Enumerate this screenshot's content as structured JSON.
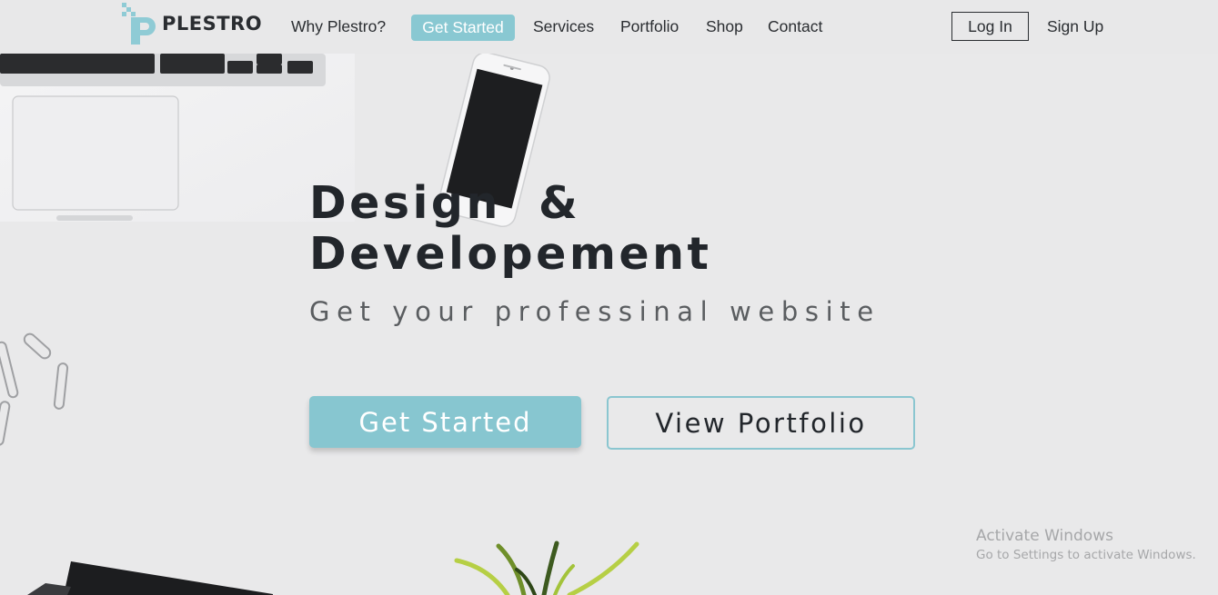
{
  "brand": {
    "name": "PLESTRO",
    "accent": "#89c8d2",
    "logo_icon": "p-pixel-logo-icon"
  },
  "nav": {
    "links": [
      "Why Plestro?",
      "Services",
      "Portfolio",
      "Shop",
      "Contact"
    ],
    "cta_label": "Get Started",
    "login_label": "Log In",
    "signup_label": "Sign Up"
  },
  "hero": {
    "title_line1": "Design  &",
    "title_line2": "Developement",
    "subtitle": "Get your professinal website",
    "primary_button": "Get Started",
    "secondary_button": "View Portfolio"
  },
  "decor": [
    "laptop-image",
    "phone-image",
    "paperclips-image",
    "plant-image",
    "notebook-image"
  ],
  "watermark": {
    "title": "Activate Windows",
    "subtitle": "Go to Settings to activate Windows."
  }
}
